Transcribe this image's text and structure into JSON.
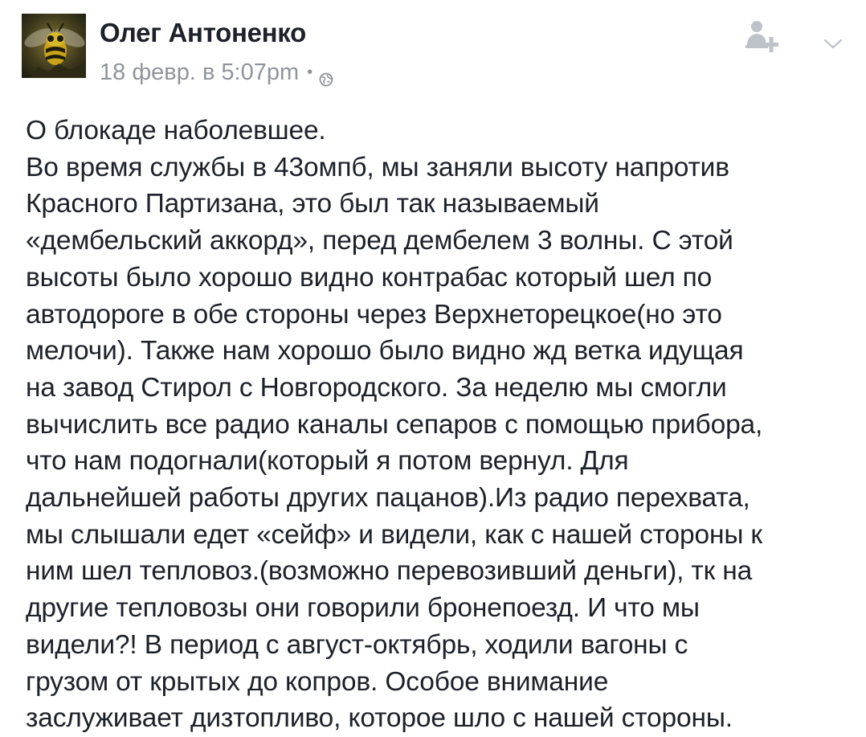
{
  "author": {
    "name": "Олег Антоненко",
    "avatar_icon": "wasp-avatar-icon"
  },
  "meta": {
    "timestamp": "18 февр. в 5:07pm",
    "separator": "•",
    "privacy_icon": "globe-icon"
  },
  "actions": {
    "add_friend_icon": "add-friend-icon",
    "menu_icon": "chevron-down-icon"
  },
  "post": {
    "lines": [
      "О блокаде наболевшее.",
      "Во время службы в 43омпб, мы заняли высоту напротив",
      "Красного Партизана, это был так называемый",
      "«дембельский аккорд», перед дембелем 3 волны. С этой",
      "высоты было хорошо видно контрабас который шел по",
      "автодороге в обе стороны через Верхнеторецкое(но это",
      "мелочи). Также нам хорошо было видно жд ветка идущая",
      "на завод Стирол с Новгородского. За неделю мы смогли",
      "вычислить все радио каналы сепаров с помощью прибора,",
      "что нам подогнали(который я потом вернул. Для",
      "дальнейшей работы других пацанов).Из радио перехвата,",
      "мы слышали едет «сейф» и видели, как с нашей стороны к",
      "ним шел тепловоз.(возможно перевозивший деньги), тк на",
      "другие тепловозы они говорили бронепоезд. И что мы",
      "видели?! В период с август-октябрь, ходили вагоны с",
      "грузом от крытых до копров. Особое внимание",
      "заслуживает дизтопливо, которое шло с нашей стороны."
    ]
  },
  "colors": {
    "text": "#1d2129",
    "meta": "#90949c",
    "icon": "#bec2c9"
  }
}
